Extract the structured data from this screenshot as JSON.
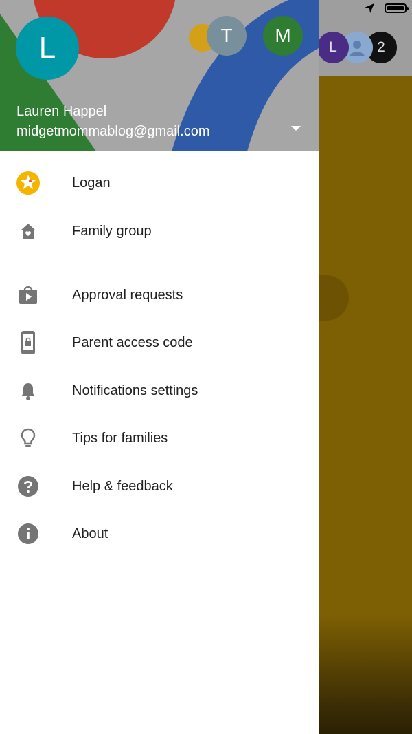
{
  "account": {
    "initial": "L",
    "name": "Lauren Happel",
    "email": "midgetmommablog@gmail.com"
  },
  "other_accounts": [
    {
      "initial": "T",
      "color": "#78909c"
    },
    {
      "initial": "M",
      "color": "#2e7d32"
    }
  ],
  "background_app": {
    "avatars": [
      {
        "initial": "L",
        "color": "#4a2c85"
      },
      {
        "initial": "",
        "color": "#8aa9d0",
        "icon": "person-icon"
      },
      {
        "initial": "2",
        "color": "#111111"
      }
    ],
    "content_color": "#7d5f04"
  },
  "menu": {
    "top_items": [
      {
        "label": "Logan",
        "icon": "child-avatar-icon"
      },
      {
        "label": "Family group",
        "icon": "home-icon"
      }
    ],
    "items": [
      {
        "label": "Approval requests",
        "icon": "play-store-icon"
      },
      {
        "label": "Parent access code",
        "icon": "phone-lock-icon"
      },
      {
        "label": "Notifications settings",
        "icon": "bell-icon"
      },
      {
        "label": "Tips for families",
        "icon": "lightbulb-icon"
      },
      {
        "label": "Help & feedback",
        "icon": "help-icon"
      },
      {
        "label": "About",
        "icon": "info-icon"
      }
    ]
  },
  "colors": {
    "header_red": "#c0392b",
    "header_green": "#2e7d32",
    "header_blue": "#2f5aa8",
    "header_yellow": "#d4a017",
    "icon_gray": "#757575"
  }
}
